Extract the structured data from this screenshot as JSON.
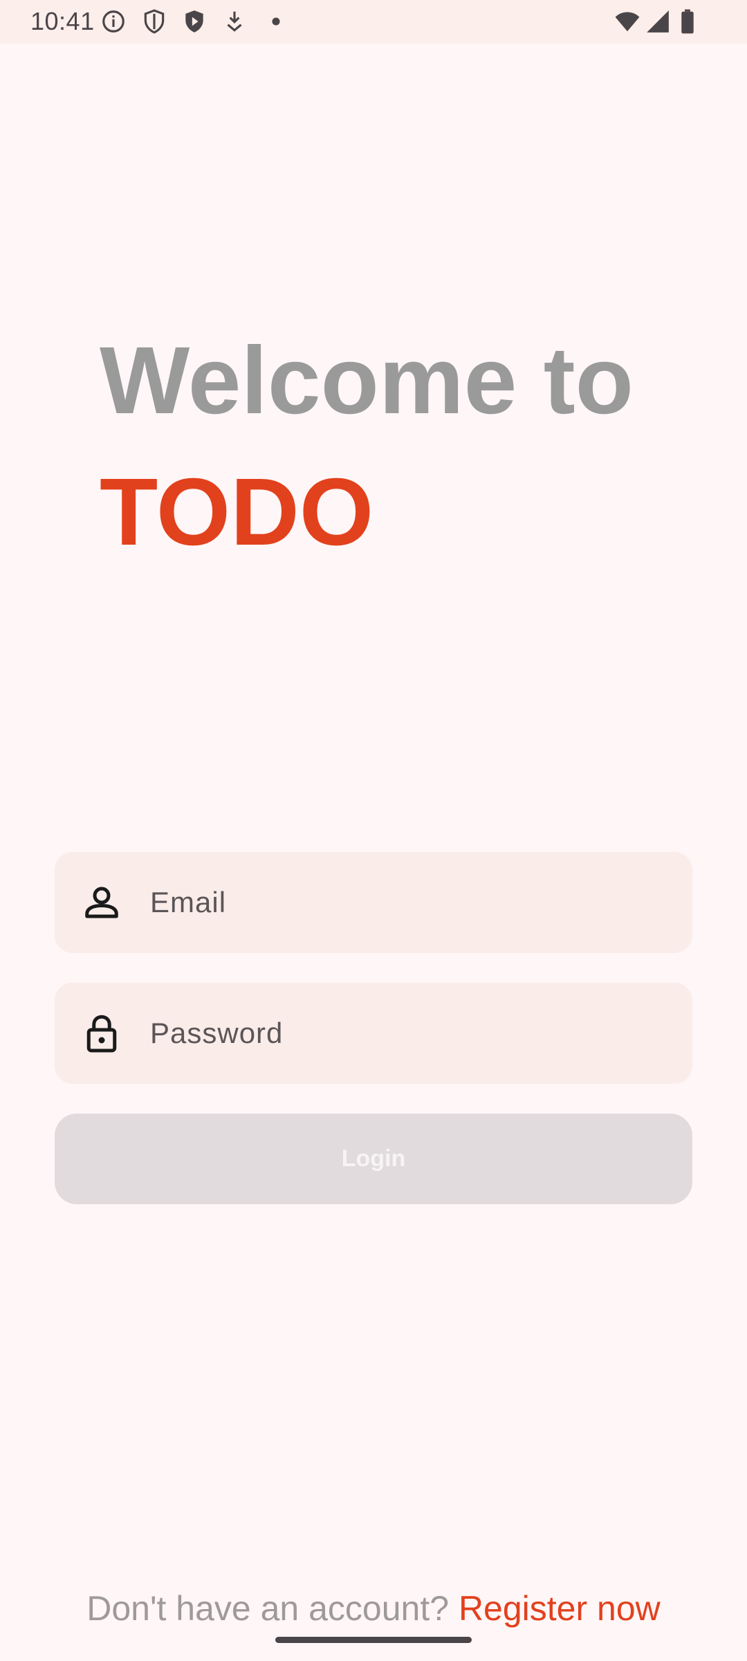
{
  "status_bar": {
    "time": "10:41",
    "left_icons": [
      "info-icon",
      "shield-outline-icon",
      "shield-play-icon",
      "download-arrow-icon",
      "dot-icon"
    ],
    "right_icons": [
      "wifi-icon",
      "cellular-signal-icon",
      "battery-icon"
    ]
  },
  "hero": {
    "line1": "Welcome to",
    "line2": "TODO"
  },
  "form": {
    "email_placeholder": "Email",
    "password_placeholder": "Password",
    "login_label": "Login"
  },
  "footer": {
    "prompt": "Don't have an account? ",
    "register_label": "Register now"
  },
  "colors": {
    "accent": "#E2411D",
    "background": "#FFF6F7",
    "field_background": "#FAECE9",
    "button_disabled": "#E1DBDD",
    "heading_gray": "#9A9A9A"
  }
}
